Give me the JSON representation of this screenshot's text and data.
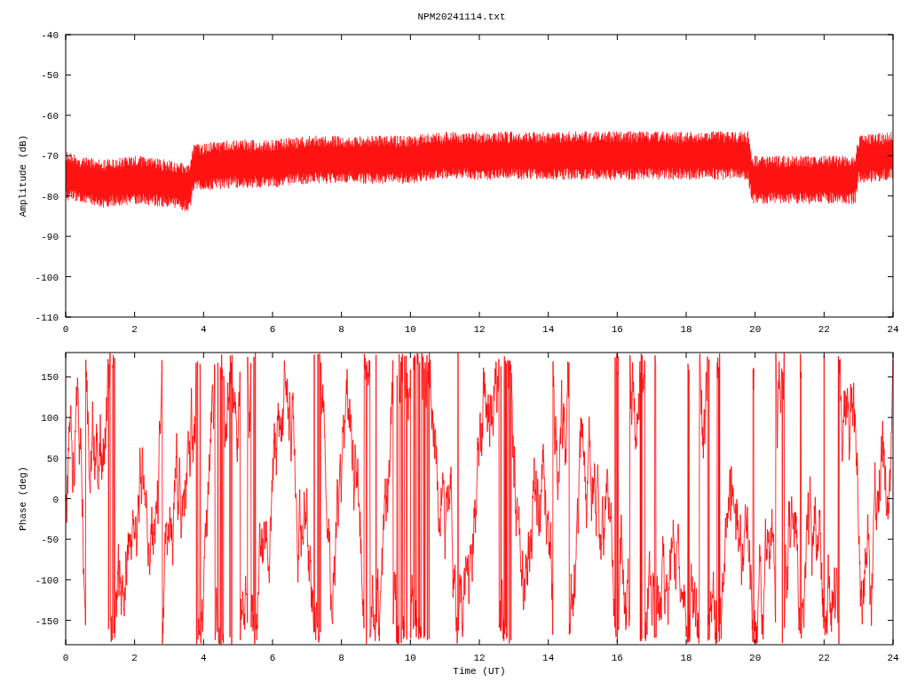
{
  "title": "NPM20241114.txt",
  "amplitude_plot": {
    "ylabel": "Amplitude (dB)",
    "xticks": [
      "0",
      "2",
      "4",
      "6",
      "8",
      "10",
      "12",
      "14",
      "16",
      "18",
      "20",
      "22",
      "24"
    ],
    "yticks": [
      "-40",
      "-50",
      "-60",
      "-70",
      "-80",
      "-90",
      "-100",
      "-110"
    ]
  },
  "phase_plot": {
    "ylabel": "Phase (deg)",
    "xlabel": "Time (UT)",
    "xticks": [
      "0",
      "2",
      "4",
      "6",
      "8",
      "10",
      "12",
      "14",
      "16",
      "18",
      "20",
      "22",
      "24"
    ],
    "yticks": [
      "150",
      "100",
      "50",
      "0",
      "-50",
      "-100",
      "-150"
    ]
  }
}
